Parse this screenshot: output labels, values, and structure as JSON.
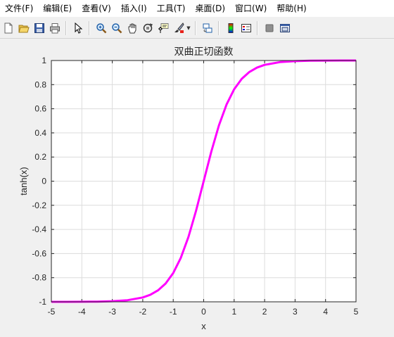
{
  "menubar": {
    "items": [
      {
        "name": "menu-file",
        "label": "文件(F)"
      },
      {
        "name": "menu-edit",
        "label": "编辑(E)"
      },
      {
        "name": "menu-view",
        "label": "查看(V)"
      },
      {
        "name": "menu-insert",
        "label": "插入(I)"
      },
      {
        "name": "menu-tools",
        "label": "工具(T)"
      },
      {
        "name": "menu-desktop",
        "label": "桌面(D)"
      },
      {
        "name": "menu-window",
        "label": "窗口(W)"
      },
      {
        "name": "menu-help",
        "label": "帮助(H)"
      }
    ]
  },
  "toolbar": {
    "icons": [
      "new-figure-icon",
      "open-file-icon",
      "save-icon",
      "print-icon",
      "pointer-icon",
      "zoom-in-icon",
      "zoom-out-icon",
      "pan-icon",
      "rotate-3d-icon",
      "data-cursor-icon",
      "brush-icon",
      "link-plot-icon",
      "colorbar-icon",
      "legend-icon",
      "hide-plot-tools-icon",
      "show-plot-tools-icon"
    ]
  },
  "colors": {
    "curve": "#ff00ff",
    "grid": "#dcdcdc",
    "axes": "#262626",
    "plot_bg": "#ffffff"
  },
  "chart_data": {
    "type": "line",
    "title": "双曲正切函数",
    "xlabel": "x",
    "ylabel": "tanh(x)",
    "xlim": [
      -5,
      5
    ],
    "ylim": [
      -1,
      1
    ],
    "xticks": [
      -5,
      -4,
      -3,
      -2,
      -1,
      0,
      1,
      2,
      3,
      4,
      5
    ],
    "yticks": [
      -1,
      -0.8,
      -0.6,
      -0.4,
      -0.2,
      0,
      0.2,
      0.4,
      0.6,
      0.8,
      1
    ],
    "xtick_labels": [
      "-5",
      "-4",
      "-3",
      "-2",
      "-1",
      "0",
      "1",
      "2",
      "3",
      "4",
      "5"
    ],
    "ytick_labels": [
      "-1",
      "-0.8",
      "-0.6",
      "-0.4",
      "-0.2",
      "0",
      "0.2",
      "0.4",
      "0.6",
      "0.8",
      "1"
    ],
    "grid": true,
    "series": [
      {
        "x": [
          -5,
          -4.5,
          -4,
          -3.5,
          -3,
          -2.5,
          -2,
          -1.75,
          -1.5,
          -1.25,
          -1,
          -0.75,
          -0.5,
          -0.25,
          0,
          0.25,
          0.5,
          0.75,
          1,
          1.25,
          1.5,
          1.75,
          2,
          2.5,
          3,
          3.5,
          4,
          4.5,
          5
        ],
        "y": [
          -0.9999,
          -0.9998,
          -0.9993,
          -0.9982,
          -0.9951,
          -0.9866,
          -0.964,
          -0.9414,
          -0.9051,
          -0.8483,
          -0.7616,
          -0.6351,
          -0.4621,
          -0.2449,
          0,
          0.2449,
          0.4621,
          0.6351,
          0.7616,
          0.8483,
          0.9051,
          0.9414,
          0.964,
          0.9866,
          0.9951,
          0.9982,
          0.9993,
          0.9998,
          0.9999
        ]
      }
    ]
  }
}
